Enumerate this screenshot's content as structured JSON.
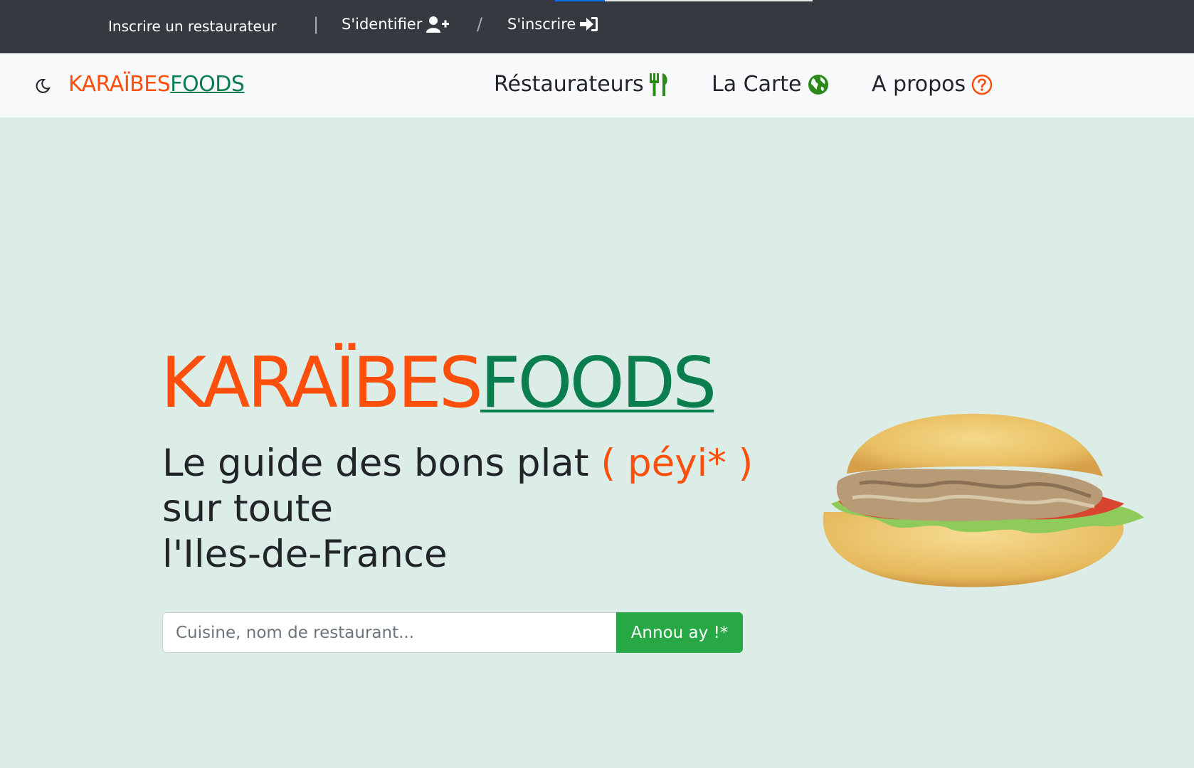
{
  "topbar": {
    "register_restaurant": "Inscrire un restaurateur",
    "sep1": "|",
    "login": "S'identifier",
    "sep2": "/",
    "signup": "S'inscrire"
  },
  "navbar": {
    "brand_part1": "KARAÏBES",
    "brand_part2": "FOODS",
    "links": [
      {
        "label": "Réstaurateurs",
        "icon": "utensils-icon"
      },
      {
        "label": "La Carte",
        "icon": "globe-icon"
      },
      {
        "label": "A propos",
        "icon": "question-circle-icon"
      }
    ]
  },
  "hero": {
    "brand_part1": "KARAÏBES",
    "brand_part2": "FOODS",
    "tagline_line1": "Le guide des bons plat",
    "tagline_peyi": "( péyi* )",
    "tagline_line2": "sur toute",
    "tagline_line3": "l'Iles-de-France",
    "search_placeholder": "Cuisine, nom de restaurant...",
    "search_button": "Annou ay !*"
  },
  "colors": {
    "accent_orange": "#fc4f0b",
    "accent_green": "#0a7e4e",
    "button_green": "#28a745",
    "topbar_bg": "#343a40",
    "page_bg": "#dcece6"
  }
}
